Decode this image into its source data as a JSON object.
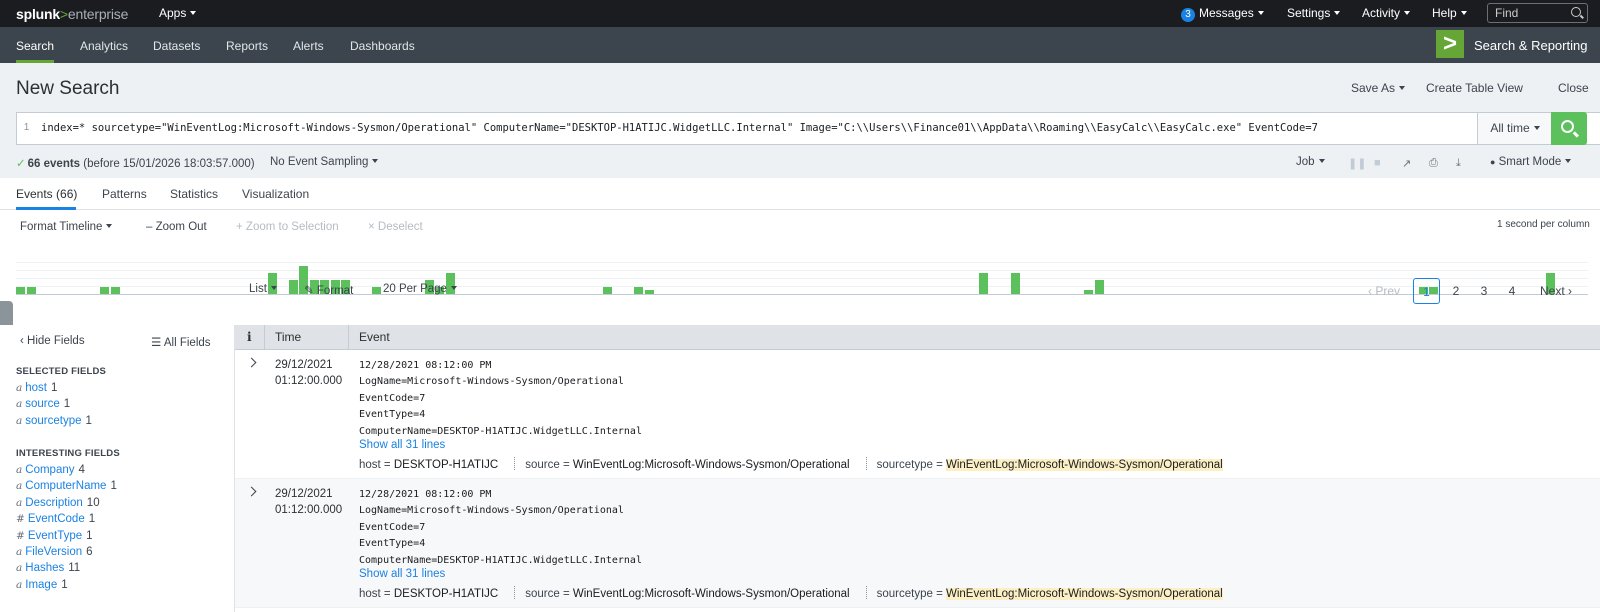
{
  "topbar": {
    "logo_splunk": "splunk",
    "logo_gt": ">",
    "logo_enterprise": "enterprise",
    "apps": "Apps",
    "messages_count": "3",
    "messages": "Messages",
    "settings": "Settings",
    "activity": "Activity",
    "help": "Help",
    "find_placeholder": "Find"
  },
  "navbar": {
    "items": [
      "Search",
      "Analytics",
      "Datasets",
      "Reports",
      "Alerts",
      "Dashboards"
    ],
    "active": "Search",
    "app_icon": ">",
    "app_name": "Search & Reporting"
  },
  "header": {
    "title": "New Search",
    "save_as": "Save As",
    "create_table_view": "Create Table View",
    "close": "Close"
  },
  "search": {
    "line_number": "1",
    "query": "index=* sourcetype=\"WinEventLog:Microsoft-Windows-Sysmon/Operational\" ComputerName=\"DESKTOP-H1ATIJC.WidgetLLC.Internal\" Image=\"C:\\\\Users\\\\Finance01\\\\AppData\\\\Roaming\\\\EasyCalc\\\\EasyCalc.exe\" EventCode=7",
    "time_range": "All time"
  },
  "status": {
    "check": "✓",
    "events_bold": "66 events",
    "events_rest": "(before 15/01/2026 18:03:57.000)",
    "sampling": "No Event Sampling",
    "job": "Job",
    "mode": "Smart Mode"
  },
  "tabs": [
    "Events (66)",
    "Patterns",
    "Statistics",
    "Visualization"
  ],
  "timeline": {
    "format": "Format Timeline",
    "zoom_out": "Zoom Out",
    "zoom_selection": "Zoom to Selection",
    "deselect": "Deselect",
    "scale": "1 second per column",
    "bar_color": "#5cc05c",
    "bars": [
      0.25,
      0.25,
      0.25,
      0.25,
      0.25,
      0.25,
      0.75,
      0.5,
      1.0,
      0.5,
      0.5,
      0.5,
      0.5,
      0.5,
      0.25,
      0.5,
      0.25,
      0.75,
      0.25,
      0.25,
      0.125,
      0.75,
      0.75,
      0.125,
      0.5,
      0.25,
      0.25,
      0.75
    ]
  },
  "controls": {
    "list": "List",
    "format": "Format",
    "per_page": "20 Per Page",
    "prev": "Prev",
    "pages": [
      "1",
      "2",
      "3",
      "4"
    ],
    "current_page": "1",
    "next": "Next"
  },
  "sidebar": {
    "hide_fields": "Hide Fields",
    "all_fields": "All Fields",
    "selected_header": "SELECTED FIELDS",
    "selected": [
      {
        "type": "a",
        "name": "host",
        "count": "1"
      },
      {
        "type": "a",
        "name": "source",
        "count": "1"
      },
      {
        "type": "a",
        "name": "sourcetype",
        "count": "1"
      }
    ],
    "interesting_header": "INTERESTING FIELDS",
    "interesting": [
      {
        "type": "a",
        "name": "Company",
        "count": "4"
      },
      {
        "type": "a",
        "name": "ComputerName",
        "count": "1"
      },
      {
        "type": "a",
        "name": "Description",
        "count": "10"
      },
      {
        "type": "#",
        "name": "EventCode",
        "count": "1"
      },
      {
        "type": "#",
        "name": "EventType",
        "count": "1"
      },
      {
        "type": "a",
        "name": "FileVersion",
        "count": "6"
      },
      {
        "type": "a",
        "name": "Hashes",
        "count": "11"
      },
      {
        "type": "a",
        "name": "Image",
        "count": "1"
      }
    ]
  },
  "table": {
    "col_info": "i",
    "col_time": "Time",
    "col_event": "Event",
    "rows": [
      {
        "date": "29/12/2021",
        "time": "01:12:00.000",
        "event": "12/28/2021 08:12:00 PM\nLogName=Microsoft-Windows-Sysmon/Operational\nEventCode=7\nEventType=4\nComputerName=DESKTOP-H1ATIJC.WidgetLLC.Internal",
        "show_all": "Show all 31 lines",
        "host_k": "host =",
        "host_v": "DESKTOP-H1ATIJC",
        "source_k": "source =",
        "source_v": "WinEventLog:Microsoft-Windows-Sysmon/Operational",
        "sourcetype_k": "sourcetype =",
        "sourcetype_v": "WinEventLog:Microsoft-Windows-Sysmon/Operational"
      },
      {
        "date": "29/12/2021",
        "time": "01:12:00.000",
        "event": "12/28/2021 08:12:00 PM\nLogName=Microsoft-Windows-Sysmon/Operational\nEventCode=7\nEventType=4\nComputerName=DESKTOP-H1ATIJC.WidgetLLC.Internal",
        "show_all": "Show all 31 lines",
        "host_k": "host =",
        "host_v": "DESKTOP-H1ATIJC",
        "source_k": "source =",
        "source_v": "WinEventLog:Microsoft-Windows-Sysmon/Operational",
        "sourcetype_k": "sourcetype =",
        "sourcetype_v": "WinEventLog:Microsoft-Windows-Sysmon/Operational"
      }
    ]
  }
}
